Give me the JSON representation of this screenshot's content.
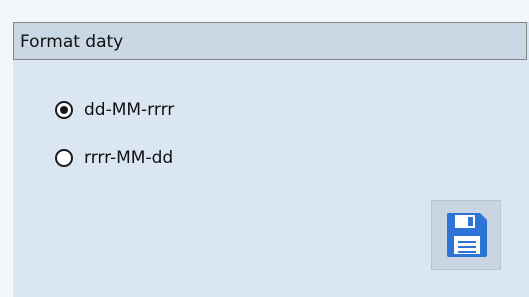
{
  "group": {
    "title": "Format daty"
  },
  "date_format": {
    "options": [
      {
        "label": "dd-MM-rrrr",
        "checked": true
      },
      {
        "label": "rrrr-MM-dd",
        "checked": false
      }
    ]
  },
  "save_button": {
    "icon": "floppy-disk-icon",
    "color": "#2e73d6"
  }
}
